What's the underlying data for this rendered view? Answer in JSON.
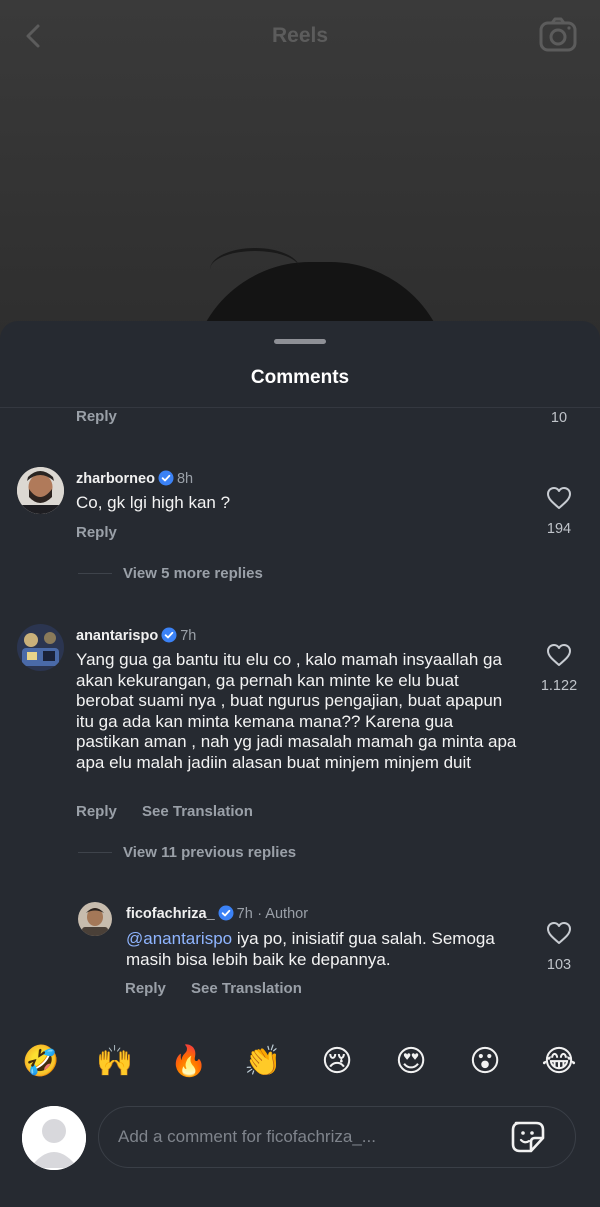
{
  "header": {
    "title": "Reels"
  },
  "sheet": {
    "title": "Comments"
  },
  "prev_comment": {
    "reply_label": "Reply",
    "likes": "10"
  },
  "comments": [
    {
      "username": "zharborneo",
      "time": "8h",
      "text": "Co, gk lgi high kan ?",
      "reply_label": "Reply",
      "likes": "194",
      "view_replies": "View 5 more replies"
    },
    {
      "username": "anantarispo",
      "time": "7h",
      "text": "Yang gua ga bantu itu elu co , kalo mamah insyaallah ga akan kekurangan, ga pernah kan minte ke elu buat berobat suami nya , buat ngurus pengajian, buat apapun itu ga ada kan minta kemana mana?? Karena gua pastikan aman , nah yg jadi masalah mamah ga minta apa apa elu malah jadiin alasan buat minjem minjem duit",
      "reply_label": "Reply",
      "translation_label": "See Translation",
      "likes": "1.122",
      "view_replies": "View 11 previous replies"
    }
  ],
  "reply": {
    "username": "ficofachriza_",
    "time": "7h",
    "author_label": "· Author",
    "mention": "@anantarispo",
    "text": " iya po, inisiatif gua salah. Semoga masih bisa lebih baik ke depannya.",
    "reply_label": "Reply",
    "translation_label": "See Translation",
    "likes": "103"
  },
  "emoji_bar": [
    "🤣",
    "🙌",
    "🔥",
    "👏",
    "😢",
    "😍",
    "😮",
    "😂"
  ],
  "composer": {
    "placeholder": "Add a comment for ficofachriza_..."
  },
  "colors": {
    "sheet_bg": "#262a31",
    "verified": "#3b82f6",
    "mention": "#8fb5ff"
  }
}
